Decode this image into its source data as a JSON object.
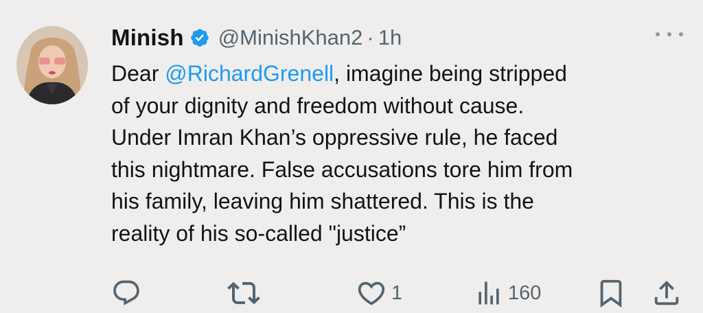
{
  "user": {
    "name": "Minish",
    "handle": "@MinishKhan2",
    "separator": "·",
    "time": "1h"
  },
  "tweet": {
    "lines": [
      {
        "pre": "Dear ",
        "mention": "@RichardGrenell",
        "post": ", imagine being stripped"
      },
      {
        "text": "of your dignity and freedom without cause."
      },
      {
        "text": "Under Imran Khan’s oppressive rule, he faced"
      },
      {
        "text": "this nightmare. False accusations tore him from"
      },
      {
        "text": "his family, leaving him shattered. This is the"
      },
      {
        "text": "reality of his so-called \"justice”"
      }
    ]
  },
  "actions": {
    "reply_icon": "reply-icon",
    "retweet_icon": "retweet-icon",
    "like_icon": "heart-icon",
    "like_count": "1",
    "views_icon": "views-icon",
    "views_count": "160",
    "bookmark_icon": "bookmark-icon",
    "share_icon": "share-icon"
  },
  "colors": {
    "background": "#efeeec",
    "text": "#0f1419",
    "secondary": "#536471",
    "accent": "#1d9bf0"
  }
}
